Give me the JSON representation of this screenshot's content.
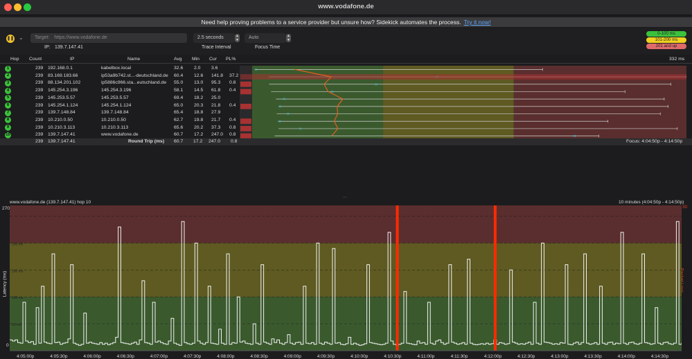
{
  "window": {
    "title": "www.vodafone.de"
  },
  "banner": {
    "text": "Need help proving problems to a service provider but unsure how? Sidekick automates the process.",
    "link": "Try it now!"
  },
  "toolbar": {
    "target_label": "Target:",
    "target_placeholder": "https://www.vodafone.de",
    "interval_value": "2.5 seconds",
    "interval_label": "Trace Interval",
    "focus_value": "Auto",
    "focus_label": "Focus Time",
    "ip_label": "IP:",
    "ip_value": "139.7.147.41"
  },
  "legend": [
    {
      "text": "0-100 ms",
      "color": "#3cc13c"
    },
    {
      "text": "101-200 ms",
      "color": "#f0d020"
    },
    {
      "text": "201 and up",
      "color": "#e06a6a"
    }
  ],
  "colors": {
    "green": "#3a5a2e",
    "yellow": "#5e5a22",
    "red": "#5a2e2e",
    "accent": "#f0c330",
    "loss": "#ff2a00"
  },
  "table": {
    "headers": {
      "hop": "Hop",
      "count": "Count",
      "ip": "IP",
      "name": "Name",
      "avg": "Avg",
      "min": "Min",
      "cur": "Cur",
      "pl": "PL%",
      "max_readout": "332 ms"
    },
    "rows": [
      {
        "hop": "1",
        "count": "239",
        "ip": "192.168.0.1",
        "name": "kabelbox.local",
        "avg": "32.6",
        "min": "2.0",
        "cur": "3.6",
        "pl": "",
        "avg_ms": 32.6,
        "min_ms": 2.0,
        "max_ms": 222,
        "cur_ms": 3.6,
        "loss_pct": 0
      },
      {
        "hop": "2",
        "count": "239",
        "ip": "83.169.183.66",
        "name": "ip53a9b742.st...-deutschland.de",
        "avg": "60.4",
        "min": "12.6",
        "cur": "141.8",
        "pl": "37.2",
        "avg_ms": 60.4,
        "min_ms": 12.6,
        "max_ms": 332,
        "cur_ms": 141.8,
        "loss_pct": 37.2
      },
      {
        "hop": "3",
        "count": "239",
        "ip": "88.134.201.102",
        "name": "ip5886c966.sta...eutschland.de",
        "avg": "55.0",
        "min": "13.0",
        "cur": "95.3",
        "pl": "0.8",
        "avg_ms": 55.0,
        "min_ms": 13.0,
        "max_ms": 320,
        "cur_ms": 95.3,
        "loss_pct": 0.8
      },
      {
        "hop": "4",
        "count": "239",
        "ip": "145.254.3.196",
        "name": "145.254.3.196",
        "avg": "58.1",
        "min": "14.5",
        "cur": "61.8",
        "pl": "0.4",
        "avg_ms": 58.1,
        "min_ms": 14.5,
        "max_ms": 285,
        "cur_ms": 61.8,
        "loss_pct": 0.4
      },
      {
        "hop": "5",
        "count": "239",
        "ip": "145.253.5.57",
        "name": "145.253.5.57",
        "avg": "69.4",
        "min": "18.2",
        "cur": "25.0",
        "pl": "",
        "avg_ms": 69.4,
        "min_ms": 18.2,
        "max_ms": 315,
        "cur_ms": 25.0,
        "loss_pct": 0
      },
      {
        "hop": "6",
        "count": "239",
        "ip": "145.254.1.124",
        "name": "145.254.1.124",
        "avg": "65.0",
        "min": "20.3",
        "cur": "21.8",
        "pl": "0.4",
        "avg_ms": 65.0,
        "min_ms": 20.3,
        "max_ms": 318,
        "cur_ms": 21.8,
        "loss_pct": 0.4
      },
      {
        "hop": "7",
        "count": "239",
        "ip": "139.7.148.84",
        "name": "139.7.148.84",
        "avg": "65.4",
        "min": "18.8",
        "cur": "27.9",
        "pl": "",
        "avg_ms": 65.4,
        "min_ms": 18.8,
        "max_ms": 312,
        "cur_ms": 27.9,
        "loss_pct": 0
      },
      {
        "hop": "8",
        "count": "239",
        "ip": "10.210.0.50",
        "name": "10.210.0.50",
        "avg": "62.7",
        "min": "19.8",
        "cur": "21.7",
        "pl": "0.4",
        "avg_ms": 62.7,
        "min_ms": 19.8,
        "max_ms": 272,
        "cur_ms": 21.7,
        "loss_pct": 0.4
      },
      {
        "hop": "9",
        "count": "239",
        "ip": "10.210.3.113",
        "name": "10.210.3.113",
        "avg": "65.6",
        "min": "20.2",
        "cur": "37.3",
        "pl": "0.8",
        "avg_ms": 65.6,
        "min_ms": 20.2,
        "max_ms": 325,
        "cur_ms": 37.3,
        "loss_pct": 0.8
      },
      {
        "hop": "10",
        "count": "239",
        "ip": "139.7.147.41",
        "name": "www.vodafone.de",
        "avg": "60.7",
        "min": "17.2",
        "cur": "247.0",
        "pl": "0.8",
        "avg_ms": 60.7,
        "min_ms": 17.2,
        "max_ms": 265,
        "cur_ms": 247.0,
        "loss_pct": 0.8
      }
    ],
    "footer": {
      "count": "239",
      "ip": "139.7.147.41",
      "label": "Round Trip (ms)",
      "avg": "60.7",
      "min": "17.2",
      "cur": "247.0",
      "pl": "0.8",
      "focus": "Focus: 4:04:50p - 4:14:50p"
    }
  },
  "timeline": {
    "title": "www.vodafone.de (139.7.147.41) hop 10",
    "range_label": "10 minutes (4:04:50p - 4:14:50p)",
    "ylabel": "Latency (ms)",
    "ylabel_right": "Packet Loss %",
    "y_top": "270",
    "y_bottom": "0",
    "y_right_top": "30",
    "band_labels": [
      "200 ms",
      "150 ms",
      "100 ms",
      "50 ms"
    ]
  },
  "chart_data": {
    "type": "line",
    "title": "www.vodafone.de (139.7.147.41) hop 10",
    "xlabel": "",
    "ylabel": "Latency (ms)",
    "ylim": [
      0,
      270
    ],
    "x_ticks": [
      "4:05:00p",
      "4:05:30p",
      "4:06:00p",
      "4:06:30p",
      "4:07:00p",
      "4:07:30p",
      "4:08:00p",
      "4:08:30p",
      "4:09:00p",
      "4:09:30p",
      "4:10:00p",
      "4:10:30p",
      "4:11:00p",
      "4:11:30p",
      "4:12:00p",
      "4:12:30p",
      "4:13:00p",
      "4:13:30p",
      "4:14:00p",
      "4:14:30p"
    ],
    "bands": [
      {
        "from": 0,
        "to": 100,
        "color": "#3a5a2e"
      },
      {
        "from": 100,
        "to": 200,
        "color": "#5e5a22"
      },
      {
        "from": 200,
        "to": 270,
        "color": "#5a2e2e"
      }
    ],
    "packet_loss_at_index": [
      146,
      183
    ],
    "series": [
      {
        "name": "",
        "values": [
          20,
          18,
          20,
          15,
          14,
          90,
          18,
          15,
          17,
          12,
          80,
          14,
          120,
          16,
          14,
          13,
          180,
          15,
          16,
          12,
          14,
          15,
          22,
          160,
          14,
          12,
          10,
          12,
          70,
          14,
          16,
          14,
          13,
          12,
          15,
          12,
          14,
          11,
          13,
          15,
          25,
          230,
          15,
          14,
          13,
          12,
          14,
          16,
          12,
          20,
          130,
          15,
          14,
          12,
          90,
          16,
          18,
          15,
          13,
          12,
          18,
          60,
          14,
          12,
          10,
          240,
          15,
          13,
          12,
          14,
          200,
          18,
          14,
          12,
          15,
          120,
          14,
          13,
          12,
          40,
          14,
          12,
          180,
          12,
          15,
          14,
          100,
          16,
          18,
          14,
          13,
          12,
          50,
          14,
          12,
          160,
          16,
          14,
          12,
          22,
          15,
          20,
          14,
          12,
          15,
          30,
          14,
          12,
          15,
          16,
          12,
          120,
          14,
          13,
          15,
          12,
          200,
          14,
          12,
          16,
          14,
          12,
          190,
          14,
          15,
          12,
          11,
          13,
          25,
          12,
          14,
          12,
          10,
          11,
          13,
          160,
          15,
          14,
          13,
          12,
          11,
          12,
          14,
          220,
          18,
          12,
          10,
          12,
          14,
          110,
          14,
          13,
          12,
          11,
          18,
          14,
          15,
          12,
          90,
          14,
          12,
          18,
          20,
          15,
          12,
          14,
          160,
          16,
          14,
          12,
          13,
          15,
          12,
          170,
          14,
          12,
          11,
          12,
          13,
          12,
          14,
          12,
          13,
          20,
          12,
          15,
          14,
          12,
          13,
          150,
          16,
          14,
          12,
          13,
          12,
          14,
          16,
          12,
          90,
          14,
          12,
          200,
          16,
          15,
          14,
          12,
          13,
          12,
          15,
          14,
          160,
          12,
          11,
          14,
          16,
          12,
          15,
          180,
          14,
          12,
          13,
          15,
          12,
          120,
          14,
          12,
          15,
          16,
          12,
          14,
          13,
          220,
          14,
          12,
          15,
          16,
          13,
          12,
          14,
          180,
          15,
          14,
          12,
          13,
          80,
          14,
          12,
          15,
          16,
          13,
          12,
          14,
          240,
          12,
          14
        ]
      }
    ]
  }
}
